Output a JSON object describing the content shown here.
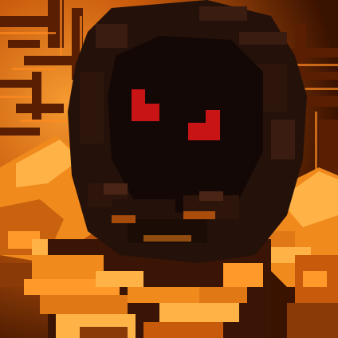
{
  "scene": {
    "subject": "voxel-hooded-figure",
    "colors": {
      "background_glow": "#f07a18",
      "background_dark": "#3a1200",
      "hood_dark": "#140806",
      "hood_mid": "#24110a",
      "hood_edge": "#3a1c10",
      "armor_bright": "#ffb347",
      "armor_mid": "#f08a1c",
      "armor_dark": "#8a3a06",
      "armor_shadow": "#3a1404",
      "eyes": "#c81414"
    }
  }
}
